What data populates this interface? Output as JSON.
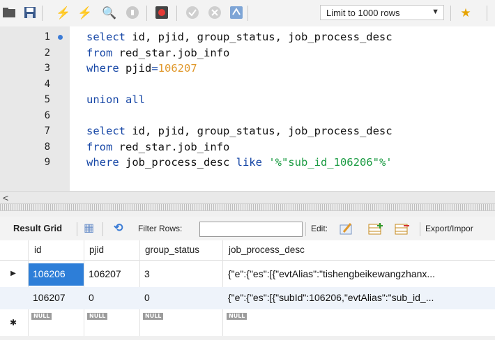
{
  "toolbar": {
    "icons": [
      "folder-icon",
      "save-icon",
      "execute-icon",
      "execute-current-icon",
      "explain-icon",
      "stop-icon",
      "toggle-icon",
      "commit-icon",
      "rollback-icon",
      "autocommit-icon",
      "bookmark-icon"
    ],
    "limit_label": "Limit to 1000 rows"
  },
  "editor": {
    "lines": [
      {
        "n": "1",
        "marker": true,
        "tokens": [
          [
            "kw",
            "select "
          ],
          [
            "id",
            "id, pjid, group_status, job_process_desc"
          ]
        ]
      },
      {
        "n": "2",
        "tokens": [
          [
            "kw",
            "from "
          ],
          [
            "id",
            "red_star.job_info"
          ]
        ]
      },
      {
        "n": "3",
        "tokens": [
          [
            "kw",
            "where "
          ],
          [
            "id",
            "pjid"
          ],
          [
            "kw",
            "="
          ],
          [
            "num",
            "106207"
          ]
        ]
      },
      {
        "n": "4",
        "tokens": []
      },
      {
        "n": "5",
        "tokens": [
          [
            "kw",
            "union all"
          ]
        ]
      },
      {
        "n": "6",
        "tokens": []
      },
      {
        "n": "7",
        "tokens": [
          [
            "kw",
            "select "
          ],
          [
            "id",
            "id, pjid, group_status, job_process_desc"
          ]
        ]
      },
      {
        "n": "8",
        "tokens": [
          [
            "kw",
            "from "
          ],
          [
            "id",
            "red_star.job_info"
          ]
        ]
      },
      {
        "n": "9",
        "tokens": [
          [
            "kw",
            "where "
          ],
          [
            "id",
            "job_process_desc "
          ],
          [
            "kw",
            "like "
          ],
          [
            "str",
            "'%\"sub_id_106206\"%'"
          ]
        ]
      }
    ]
  },
  "result_toolbar": {
    "result_grid_label": "Result Grid",
    "filter_label": "Filter Rows:",
    "filter_value": "",
    "edit_label": "Edit:",
    "export_label": "Export/Impor"
  },
  "grid": {
    "columns": [
      "id",
      "pjid",
      "group_status",
      "job_process_desc"
    ],
    "rows": [
      [
        "106206",
        "106207",
        "3",
        "{\"e\":{\"es\":[{\"evtAlias\":\"tishengbeikewangzhanx..."
      ],
      [
        "106207",
        "0",
        "0",
        "{\"e\":{\"es\":[{\"subId\":106206,\"evtAlias\":\"sub_id_..."
      ]
    ],
    "null_label": "NULL"
  },
  "colors": {
    "keyword": "#1747a6",
    "number": "#e0982b",
    "string": "#1a9b42",
    "selection": "#2d7ed8"
  }
}
